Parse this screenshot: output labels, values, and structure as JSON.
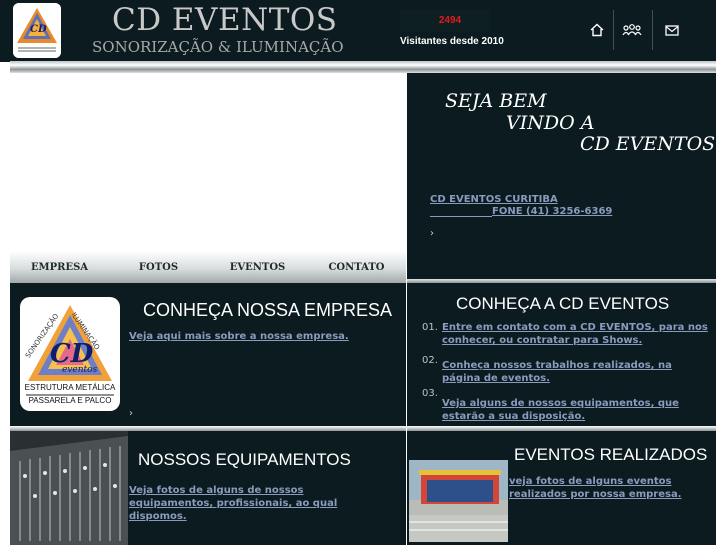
{
  "header": {
    "logo_text": [
      "SONORIZAÇÃO",
      "ILUMINAÇÃO",
      "CD",
      "eventos",
      "ESTRUTURA METÁLICA",
      "PASSARELA E PALCO"
    ],
    "title": "CD EVENTOS",
    "subtitle": "SONORIZAÇÃO & ILUMINAÇÃO",
    "visitor_count": "2494",
    "visitor_label": "Visitantes desde 2010",
    "icons": [
      "home-icon",
      "crowd-icon",
      "mail-icon"
    ]
  },
  "welcome": {
    "line1": "SEJA BEM",
    "line2": "VINDO A",
    "line3": "CD EVENTOS",
    "company_link": "CD EVENTOS CURITIBA",
    "phone_link": "FONE (41) 3256-6369",
    "arrow": "›"
  },
  "nav": {
    "items": [
      "EMPRESA",
      "FOTOS",
      "EVENTOS",
      "CONTATO"
    ]
  },
  "empresa": {
    "title": "CONHEÇA NOSSA EMPRESA",
    "link": "Veja aqui mais sobre a nossa empresa.",
    "arrow": "›"
  },
  "conheca": {
    "title": "CONHEÇA A CD EVENTOS",
    "items": [
      {
        "num": "01.",
        "text": "Entre em contato com a CD EVENTOS, para nos conhecer, ou contratar para Shows."
      },
      {
        "num": "02.",
        "text": "Conheça nossos trabalhos realizados, na página de eventos."
      },
      {
        "num": "03.",
        "text": "Veja alguns de nossos equipamentos, que estarão a sua disposição."
      }
    ]
  },
  "equipamentos": {
    "title": "NOSSOS EQUIPAMENTOS",
    "link": "Veja fotos de alguns de nossos equipamentos, profissionais, ao qual dispomos."
  },
  "eventos": {
    "title": "EVENTOS REALIZADOS",
    "link": "veja fotos de alguns eventos realizados por nossa empresa."
  },
  "colors": {
    "background": "#0b1b1f",
    "counter": "#e21b1b",
    "link": "#8a9bbd"
  }
}
